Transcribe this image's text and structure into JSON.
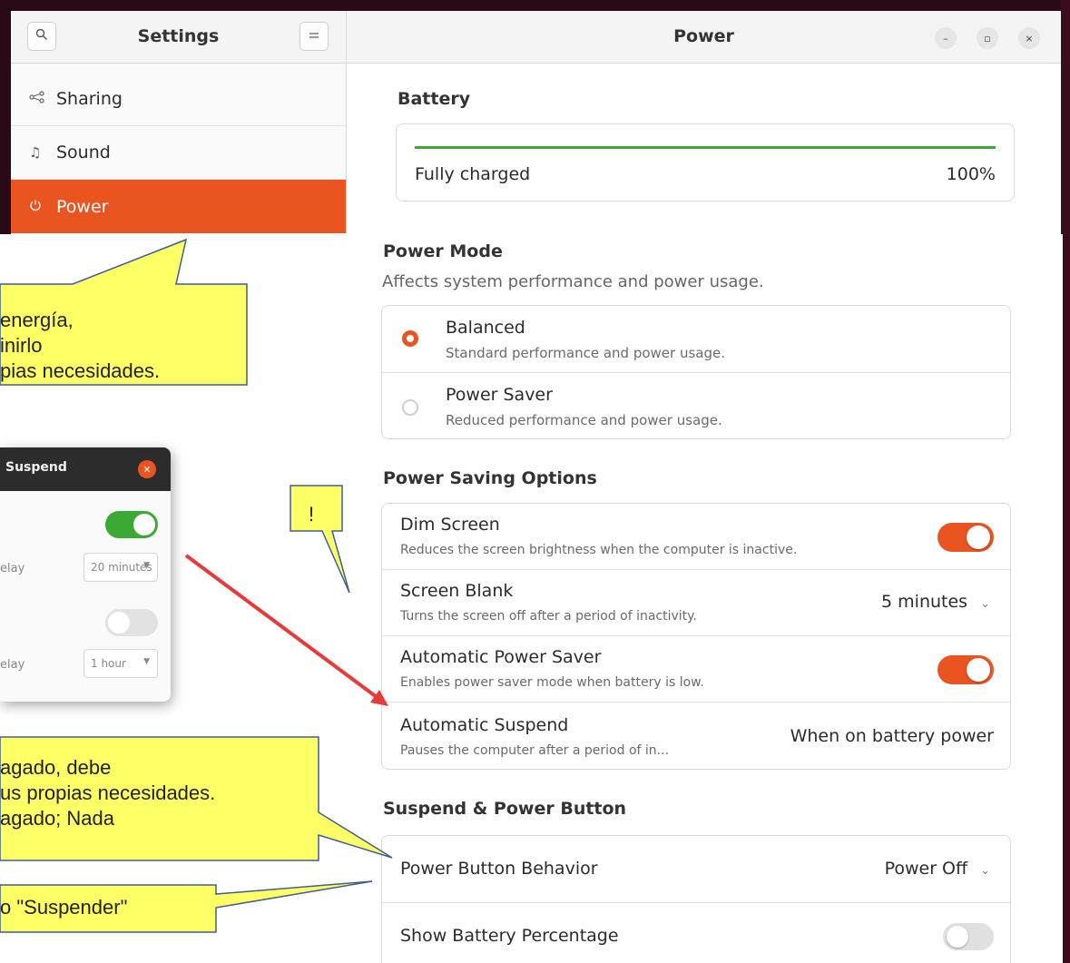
{
  "sidebar": {
    "search_icon": "search-icon",
    "title": "Settings",
    "menu_icon": "hamburger-icon",
    "items": [
      {
        "label": "Sharing",
        "icon": "share-icon"
      },
      {
        "label": "Sound",
        "icon": "music-note-icon"
      },
      {
        "label": "Power",
        "icon": "power-icon",
        "active": true
      }
    ]
  },
  "header": {
    "title": "Power",
    "minimize": "–",
    "maximize": "▫",
    "close": "×"
  },
  "battery": {
    "section_title": "Battery",
    "status": "Fully charged",
    "percent": "100%",
    "level": 1.0,
    "bar_color": "#3aaa35"
  },
  "power_mode": {
    "section_title": "Power Mode",
    "subtitle": "Affects system performance and power usage.",
    "options": [
      {
        "title": "Balanced",
        "subtitle": "Standard performance and power usage.",
        "selected": true
      },
      {
        "title": "Power Saver",
        "subtitle": "Reduced performance and power usage.",
        "selected": false
      }
    ]
  },
  "power_saving": {
    "section_title": "Power Saving Options",
    "dim_screen": {
      "title": "Dim Screen",
      "subtitle": "Reduces the screen brightness when the computer is inactive.",
      "on": true
    },
    "screen_blank": {
      "title": "Screen Blank",
      "subtitle": "Turns the screen off after a period of inactivity.",
      "value": "5 minutes"
    },
    "auto_power_saver": {
      "title": "Automatic Power Saver",
      "subtitle": "Enables power saver mode when battery is low.",
      "on": true
    },
    "auto_suspend": {
      "title": "Automatic Suspend",
      "subtitle": "Pauses the computer after a period of in...",
      "value": "When on battery power"
    }
  },
  "suspend_button": {
    "section_title": "Suspend & Power Button",
    "power_button": {
      "title": "Power Button Behavior",
      "value": "Power Off"
    },
    "battery_pct": {
      "title": "Show Battery Percentage",
      "on": false
    }
  },
  "dialog": {
    "title": "Suspend",
    "close_icon": "close-icon",
    "delay1_label": "elay",
    "delay1_value": "20 minutes",
    "delay2_label": "elay",
    "delay2_value": "1 hour"
  },
  "callouts": {
    "c1": "energía,\ninirlo\npias necesidades.",
    "c2": "!",
    "c3": "agado, debe\nus propias necesidades.\nagado; Nada",
    "c4": "o \"Suspender\""
  },
  "colors": {
    "accent": "#e95420",
    "callout_fill": "#ffff66",
    "callout_border": "#3e5e94",
    "arrow": "#e83a3a"
  }
}
